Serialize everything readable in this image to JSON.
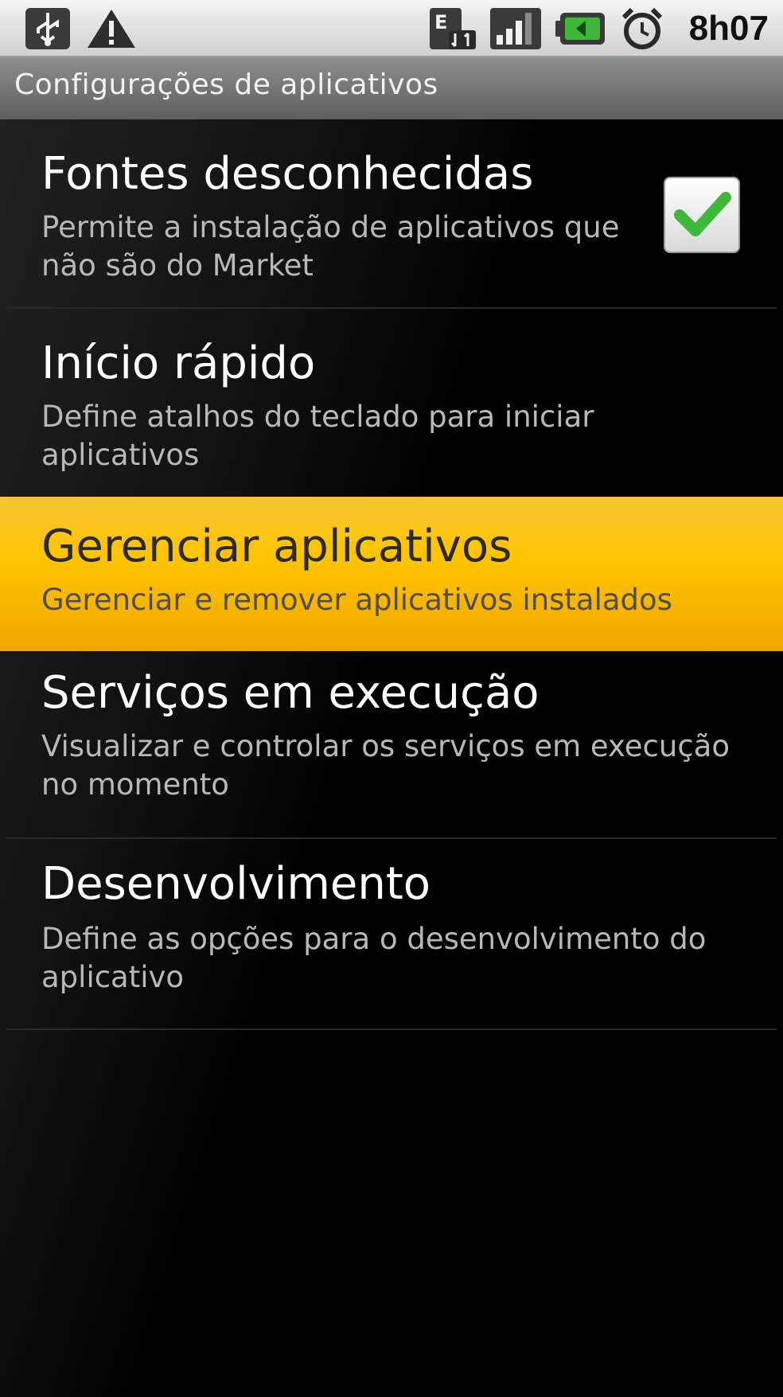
{
  "status_bar": {
    "time": "8h07",
    "icons": [
      "usb-icon",
      "warning-icon",
      "edge-data-icon",
      "signal-icon",
      "battery-icon",
      "alarm-icon"
    ]
  },
  "header": {
    "title": "Configurações de aplicativos"
  },
  "settings": {
    "items": [
      {
        "title": "Fontes desconhecidas",
        "summary": "Permite a instalação de aplicativos que não são do Market",
        "checked": true
      },
      {
        "title": "Início rápido",
        "summary": "Define atalhos do teclado para iniciar aplicativos"
      },
      {
        "title": "Gerenciar aplicativos",
        "summary": "Gerenciar e remover aplicativos instalados",
        "selected": true
      },
      {
        "title": "Serviços em execução",
        "summary": "Visualizar e controlar os serviços em execução no momento"
      },
      {
        "title": "Desenvolvimento",
        "summary": "Define as opções para o desenvolvimento do aplicativo"
      }
    ]
  },
  "colors": {
    "selection": "#ffc400",
    "checkmark": "#3fb83a"
  }
}
